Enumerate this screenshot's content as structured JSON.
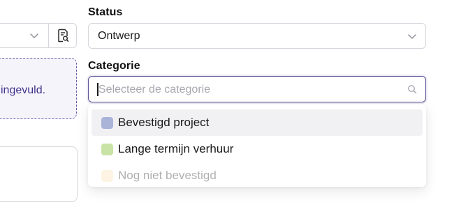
{
  "left_panel": {
    "info_message": "ingevuld.",
    "icon_button": "document-search-icon"
  },
  "status": {
    "label": "Status",
    "value": "Ontwerp"
  },
  "category": {
    "label": "Categorie",
    "placeholder": "Selecteer de categorie",
    "options": [
      {
        "label": "Bevestigd project",
        "color": "#a9b4d8",
        "highlighted": true
      },
      {
        "label": "Lange termijn verhuur",
        "color": "#c9e3a6",
        "highlighted": false
      },
      {
        "label": "Nog niet bevestigd",
        "color": "#f9dfb0",
        "highlighted": false
      }
    ]
  },
  "colors": {
    "focus_border": "#5b4f96",
    "dashed_border": "#6b5aa8",
    "info_text": "#3f338a"
  }
}
